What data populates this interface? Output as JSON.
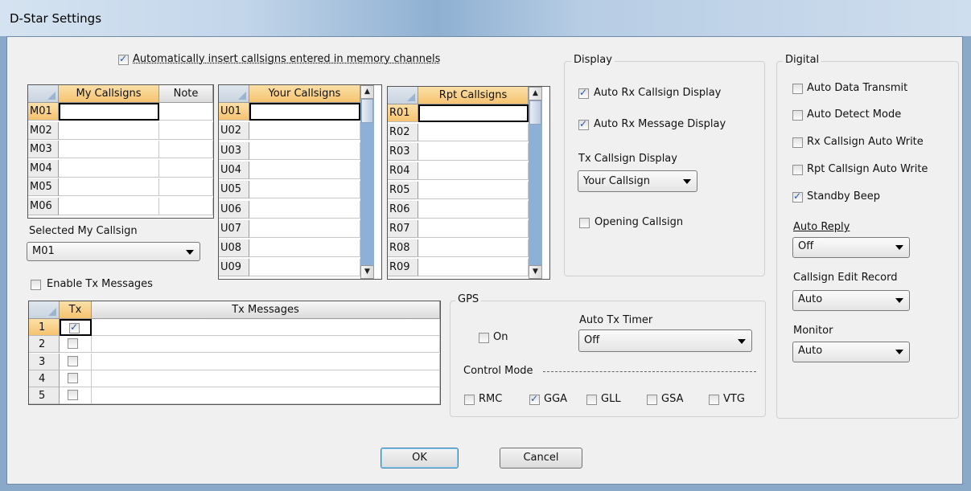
{
  "window": {
    "title": "D-Star Settings"
  },
  "auto_insert": {
    "label": "Automatically insert callsigns entered in memory channels",
    "checked": true
  },
  "my_callsigns": {
    "headers": [
      "My Callsigns",
      "Note"
    ],
    "rows": [
      "M01",
      "M02",
      "M03",
      "M04",
      "M05",
      "M06"
    ]
  },
  "selected_my_callsign": {
    "label": "Selected My Callsign",
    "value": "M01"
  },
  "your_callsigns": {
    "header": "Your Callsigns",
    "rows": [
      "U01",
      "U02",
      "U03",
      "U04",
      "U05",
      "U06",
      "U07",
      "U08",
      "U09"
    ]
  },
  "rpt_callsigns": {
    "header": "Rpt Callsigns",
    "rows": [
      "R01",
      "R02",
      "R03",
      "R04",
      "R05",
      "R06",
      "R07",
      "R08",
      "R09"
    ]
  },
  "enable_tx_messages": {
    "label": "Enable Tx Messages",
    "checked": false
  },
  "tx_messages": {
    "headers": [
      "Tx",
      "Tx Messages"
    ],
    "rows": [
      {
        "num": "1",
        "checked": true
      },
      {
        "num": "2",
        "checked": false
      },
      {
        "num": "3",
        "checked": false
      },
      {
        "num": "4",
        "checked": false
      },
      {
        "num": "5",
        "checked": false
      }
    ]
  },
  "display": {
    "title": "Display",
    "auto_rx_callsign": {
      "label": "Auto Rx Callsign Display",
      "checked": true
    },
    "auto_rx_message": {
      "label": "Auto Rx Message Display",
      "checked": true
    },
    "tx_callsign_display": {
      "label": "Tx Callsign Display",
      "value": "Your Callsign"
    },
    "opening_callsign": {
      "label": "Opening Callsign",
      "checked": false
    }
  },
  "digital": {
    "title": "Digital",
    "auto_data_transmit": {
      "label": "Auto Data Transmit",
      "checked": false
    },
    "auto_detect_mode": {
      "label": "Auto Detect Mode",
      "checked": false
    },
    "rx_callsign_auto_write": {
      "label": "Rx Callsign Auto Write",
      "checked": false
    },
    "rpt_callsign_auto_write": {
      "label": "Rpt Callsign Auto Write",
      "checked": false
    },
    "standby_beep": {
      "label": "Standby Beep",
      "checked": true
    },
    "auto_reply": {
      "label": "Auto Reply",
      "value": "Off"
    },
    "callsign_edit_record": {
      "label": "Callsign Edit Record",
      "value": "Auto"
    },
    "monitor": {
      "label": "Monitor",
      "value": "Auto"
    }
  },
  "gps": {
    "title": "GPS",
    "on": {
      "label": "On",
      "checked": false
    },
    "auto_tx_timer": {
      "label": "Auto Tx Timer",
      "value": "Off"
    },
    "control_mode_label": "Control Mode",
    "modes": [
      {
        "label": "RMC",
        "checked": false
      },
      {
        "label": "GGA",
        "checked": true
      },
      {
        "label": "GLL",
        "checked": false
      },
      {
        "label": "GSA",
        "checked": false
      },
      {
        "label": "VTG",
        "checked": false
      }
    ]
  },
  "buttons": {
    "ok": "OK",
    "cancel": "Cancel"
  },
  "icons": {
    "checkbox": "checkbox-icon",
    "dropdown": "chevron-down-icon",
    "scroll_up": "arrow-up-icon",
    "scroll_down": "arrow-down-icon"
  }
}
